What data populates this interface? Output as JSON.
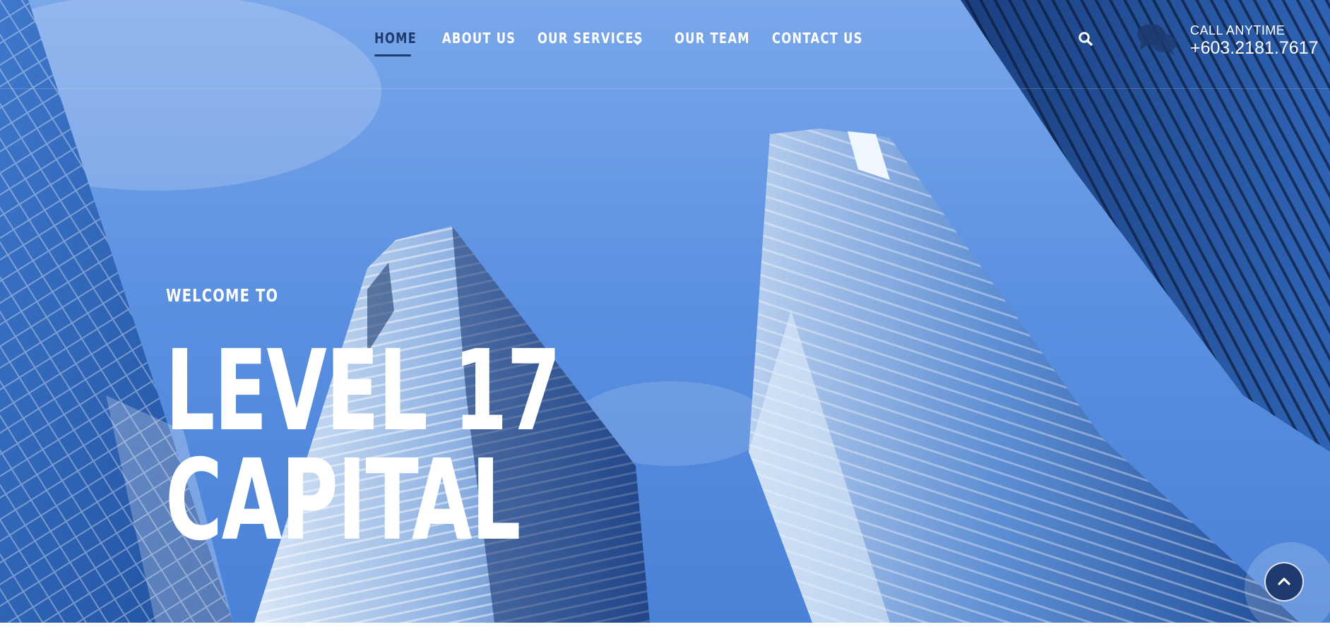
{
  "nav": {
    "items": [
      {
        "label": "HOME",
        "active": true
      },
      {
        "label": "ABOUT US"
      },
      {
        "label": "OUR SERVICES",
        "has_dropdown": true
      },
      {
        "label": "OUR TEAM"
      },
      {
        "label": "CONTACT US"
      }
    ]
  },
  "header": {
    "call_label": "CALL ANYTIME",
    "phone": "+603.2181.7617",
    "icons": [
      "search-icon",
      "chat-bubbles-icon"
    ]
  },
  "hero": {
    "kicker": "WELCOME TO",
    "title_line1": "LEVEL 17",
    "title_line2": "CAPITAL"
  },
  "colors": {
    "accent": "#1e3a6e",
    "sky": "#5b8fe0",
    "text": "#ffffff"
  },
  "scroll_top": {
    "icon": "chevron-up-icon"
  }
}
